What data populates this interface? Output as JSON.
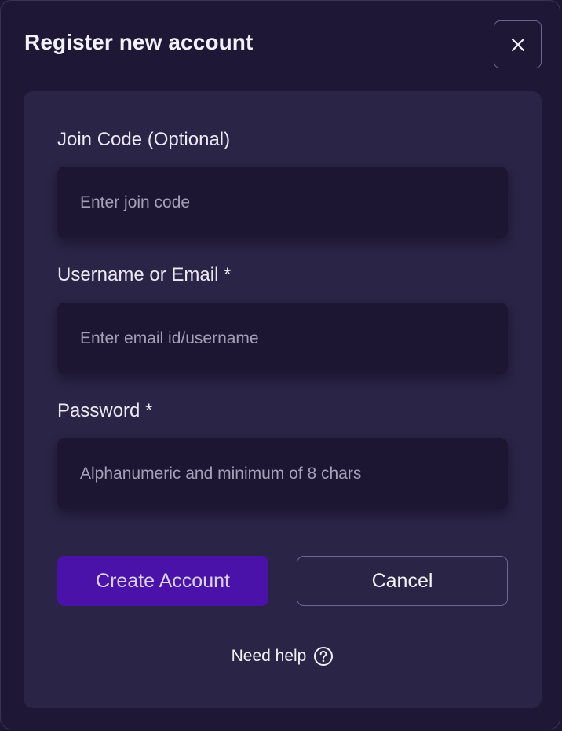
{
  "modal": {
    "title": "Register new account",
    "close_icon": "close-icon"
  },
  "form": {
    "join_code": {
      "label": "Join Code (Optional)",
      "value": "",
      "placeholder": "Enter join code"
    },
    "username": {
      "label": "Username or Email *",
      "value": "",
      "placeholder": "Enter email id/username"
    },
    "password": {
      "label": "Password *",
      "value": "",
      "placeholder": "Alphanumeric and minimum of 8 chars"
    }
  },
  "actions": {
    "create_label": "Create Account",
    "cancel_label": "Cancel"
  },
  "help": {
    "label": "Need help",
    "icon": "question-circle-icon"
  },
  "colors": {
    "background": "#1e1836",
    "card": "#2a2446",
    "input": "#1c1632",
    "primary": "#4a12a8"
  }
}
